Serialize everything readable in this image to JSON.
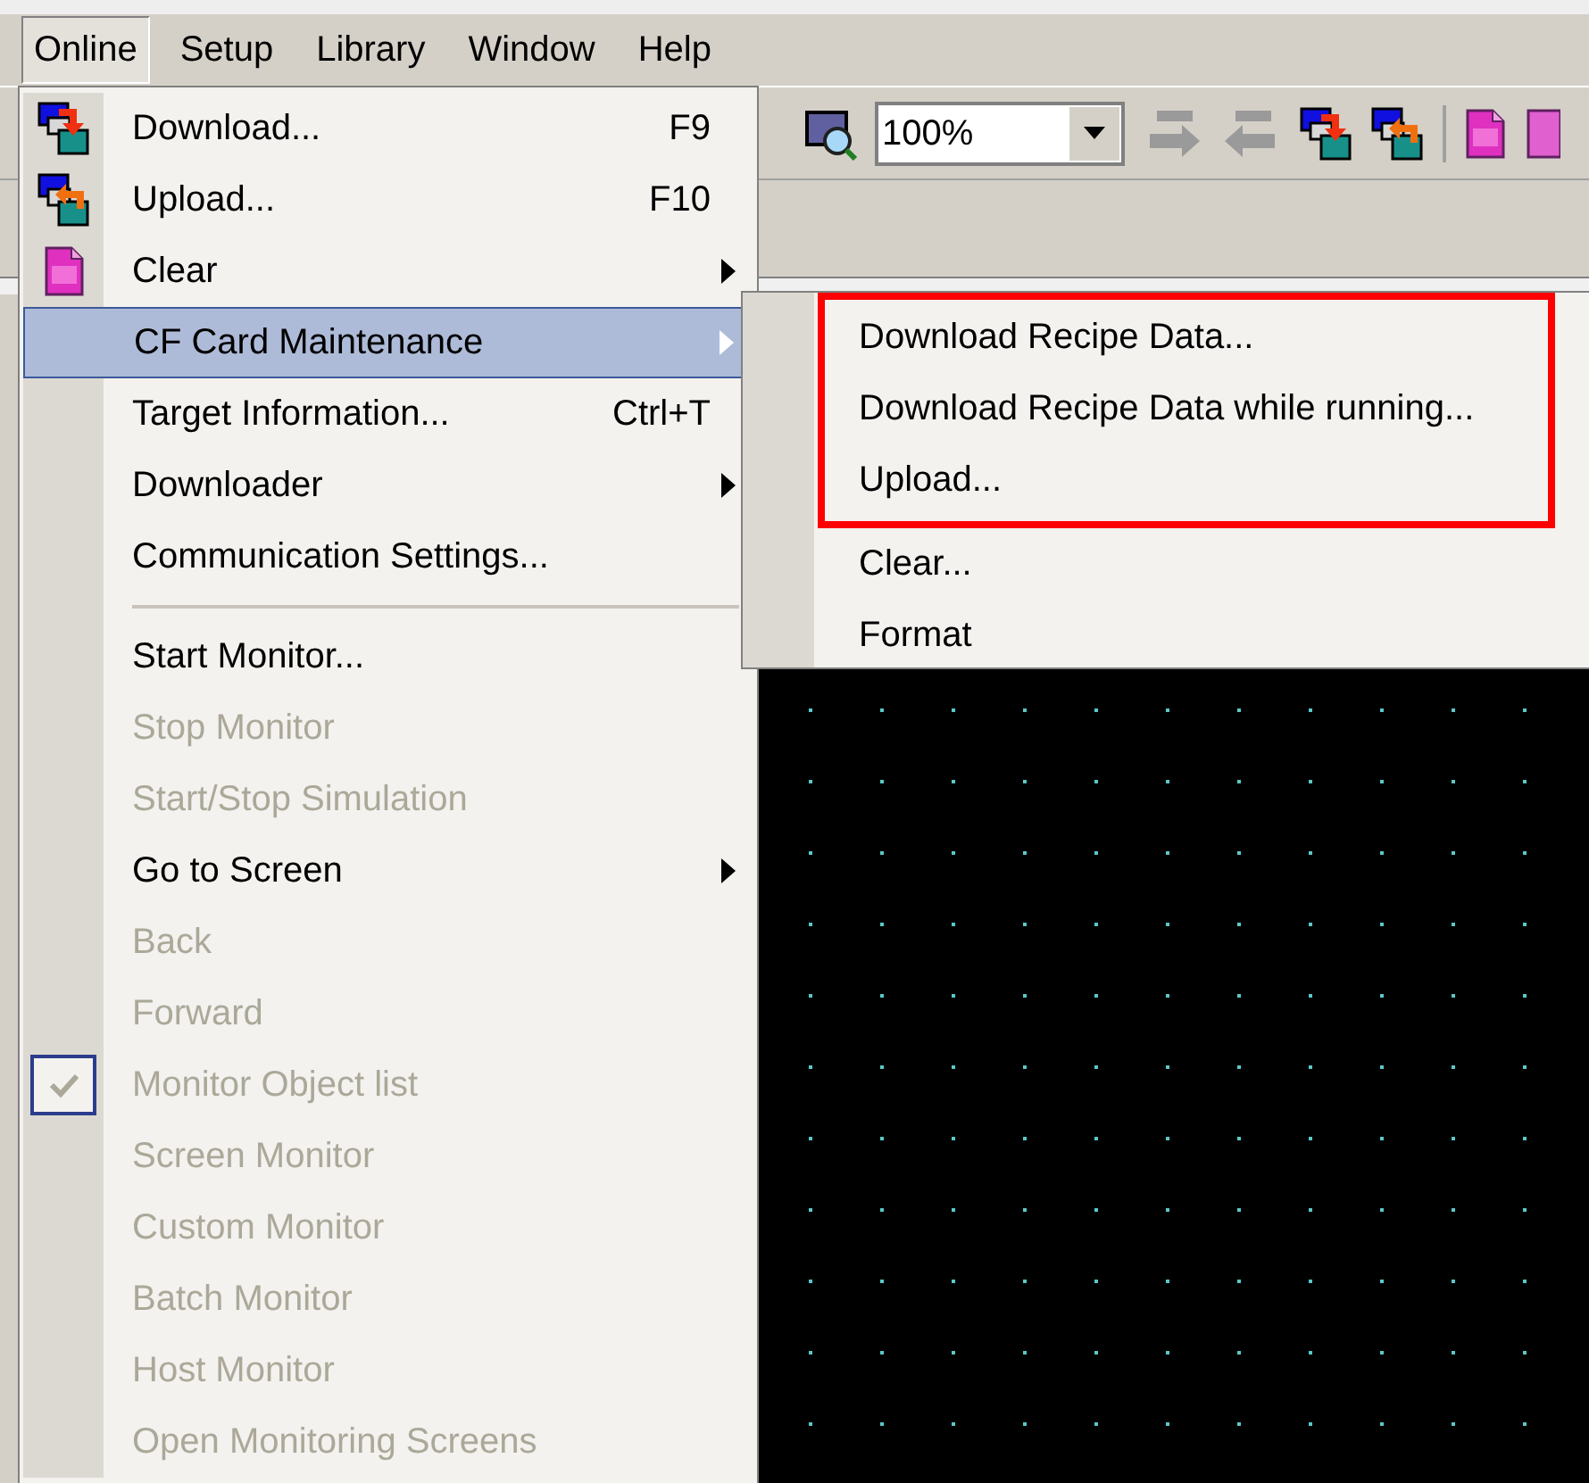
{
  "menubar": [
    {
      "label": "Online",
      "selected": true
    },
    {
      "label": "Setup",
      "selected": false
    },
    {
      "label": "Library",
      "selected": false
    },
    {
      "label": "Window",
      "selected": false
    },
    {
      "label": "Help",
      "selected": false
    }
  ],
  "toolbar": {
    "zoom": {
      "value": "100%"
    }
  },
  "menu": {
    "items": [
      {
        "kind": "item",
        "label": "Download...",
        "shortcut": "F9",
        "disabled": false,
        "selected": false,
        "submenu": false
      },
      {
        "kind": "item",
        "label": "Upload...",
        "shortcut": "F10",
        "disabled": false,
        "selected": false,
        "submenu": false
      },
      {
        "kind": "item",
        "label": "Clear",
        "disabled": false,
        "selected": false,
        "submenu": true
      },
      {
        "kind": "item",
        "label": "CF Card Maintenance",
        "disabled": false,
        "selected": true,
        "submenu": true
      },
      {
        "kind": "item",
        "label": "Target Information...",
        "shortcut": "Ctrl+T",
        "disabled": false,
        "selected": false,
        "submenu": false
      },
      {
        "kind": "item",
        "label": "Downloader",
        "disabled": false,
        "selected": false,
        "submenu": true
      },
      {
        "kind": "item",
        "label": "Communication Settings...",
        "disabled": false,
        "selected": false,
        "submenu": false
      },
      {
        "kind": "separator"
      },
      {
        "kind": "item",
        "label": "Start Monitor...",
        "disabled": false,
        "selected": false,
        "submenu": false
      },
      {
        "kind": "item",
        "label": "Stop Monitor",
        "disabled": true,
        "selected": false,
        "submenu": false
      },
      {
        "kind": "item",
        "label": "Start/Stop Simulation",
        "disabled": true,
        "selected": false,
        "submenu": false
      },
      {
        "kind": "item",
        "label": "Go to Screen",
        "disabled": false,
        "selected": false,
        "submenu": true
      },
      {
        "kind": "item",
        "label": "Back",
        "disabled": true,
        "selected": false,
        "submenu": false
      },
      {
        "kind": "item",
        "label": "Forward",
        "disabled": true,
        "selected": false,
        "submenu": false
      },
      {
        "kind": "check",
        "label": "Monitor Object list",
        "disabled": true,
        "selected": false,
        "checked": true
      },
      {
        "kind": "item",
        "label": "Screen Monitor",
        "disabled": true,
        "selected": false,
        "submenu": false
      },
      {
        "kind": "item",
        "label": "Custom Monitor",
        "disabled": true,
        "selected": false,
        "submenu": false
      },
      {
        "kind": "item",
        "label": "Batch Monitor",
        "disabled": true,
        "selected": false,
        "submenu": false
      },
      {
        "kind": "item",
        "label": "Host Monitor",
        "disabled": true,
        "selected": false,
        "submenu": false
      },
      {
        "kind": "item",
        "label": "Open Monitoring Screens",
        "disabled": true,
        "selected": false,
        "submenu": false
      }
    ]
  },
  "submenu": {
    "sections": [
      {
        "boxed": true,
        "items": [
          {
            "label": "Download Recipe Data..."
          },
          {
            "label": "Download Recipe Data while running..."
          },
          {
            "label": "Upload..."
          }
        ]
      },
      {
        "boxed": false,
        "items": [
          {
            "label": "Clear..."
          },
          {
            "label": "Format"
          }
        ]
      }
    ]
  }
}
